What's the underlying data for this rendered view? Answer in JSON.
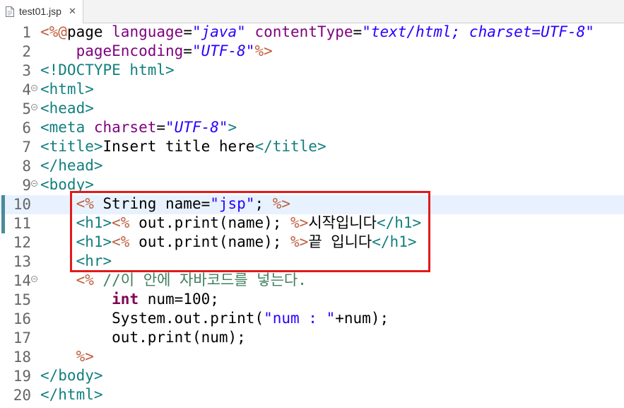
{
  "tab": {
    "label": "test01.jsp",
    "file_icon": "jsp-file-icon",
    "close_icon": "close-icon"
  },
  "colors": {
    "jsp_delimiter": "#bf5f3f",
    "tag": "#127f7f",
    "attribute": "#7f007f",
    "string": "#2a00ff",
    "keyword": "#7f0055",
    "comment": "#3f7f5f",
    "highlight": "#e21a1a",
    "current_line": "#e8f2fe"
  },
  "editor": {
    "current_line": 10,
    "highlighted_lines": [
      10,
      11,
      12,
      13
    ],
    "lines": [
      {
        "n": "1",
        "fold": false,
        "indent": "",
        "tokens": [
          [
            "jsp",
            "<%@"
          ],
          [
            "",
            "page "
          ],
          [
            "attr",
            "language"
          ],
          [
            "",
            "="
          ],
          [
            "str",
            "\"java\""
          ],
          [
            "",
            ""
          ],
          [
            "attr",
            " contentType"
          ],
          [
            "",
            "="
          ],
          [
            "str",
            "\"text/html; charset=UTF-8\""
          ]
        ]
      },
      {
        "n": "2",
        "fold": false,
        "indent": "    ",
        "tokens": [
          [
            "attr",
            "pageEncoding"
          ],
          [
            "",
            "="
          ],
          [
            "str",
            "\"UTF-8\""
          ],
          [
            "jsp",
            "%>"
          ]
        ]
      },
      {
        "n": "3",
        "fold": false,
        "indent": "",
        "tokens": [
          [
            "tag",
            "<!DOCTYPE html>"
          ]
        ]
      },
      {
        "n": "4",
        "fold": true,
        "indent": "",
        "tokens": [
          [
            "tag",
            "<html>"
          ]
        ]
      },
      {
        "n": "5",
        "fold": true,
        "indent": "",
        "tokens": [
          [
            "tag",
            "<head>"
          ]
        ]
      },
      {
        "n": "6",
        "fold": false,
        "indent": "",
        "tokens": [
          [
            "tag",
            "<meta "
          ],
          [
            "attr",
            "charset"
          ],
          [
            "",
            "="
          ],
          [
            "str",
            "\"UTF-8\""
          ],
          [
            "tag",
            ">"
          ]
        ]
      },
      {
        "n": "7",
        "fold": false,
        "indent": "",
        "tokens": [
          [
            "tag",
            "<title>"
          ],
          [
            "",
            "Insert title here"
          ],
          [
            "tag",
            "</title>"
          ]
        ]
      },
      {
        "n": "8",
        "fold": false,
        "indent": "",
        "tokens": [
          [
            "tag",
            "</head>"
          ]
        ]
      },
      {
        "n": "9",
        "fold": true,
        "indent": "",
        "tokens": [
          [
            "tag",
            "<body>"
          ]
        ]
      },
      {
        "n": "10",
        "fold": false,
        "indent": "    ",
        "tokens": [
          [
            "jsp",
            "<%"
          ],
          [
            "",
            " String name="
          ],
          [
            "javastr",
            "\"jsp\""
          ],
          [
            "",
            "; "
          ],
          [
            "jsp",
            "%>"
          ]
        ]
      },
      {
        "n": "11",
        "fold": false,
        "indent": "    ",
        "tokens": [
          [
            "tag",
            "<h1>"
          ],
          [
            "jsp",
            "<%"
          ],
          [
            "",
            " out.print(name); "
          ],
          [
            "jsp",
            "%>"
          ],
          [
            "",
            "시작입니다"
          ],
          [
            "tag",
            "</h1>"
          ]
        ]
      },
      {
        "n": "12",
        "fold": false,
        "indent": "    ",
        "tokens": [
          [
            "tag",
            "<h1>"
          ],
          [
            "jsp",
            "<%"
          ],
          [
            "",
            " out.print(name); "
          ],
          [
            "jsp",
            "%>"
          ],
          [
            "",
            "끝 입니다"
          ],
          [
            "tag",
            "</h1>"
          ]
        ]
      },
      {
        "n": "13",
        "fold": false,
        "indent": "    ",
        "tokens": [
          [
            "tag",
            "<hr>"
          ]
        ]
      },
      {
        "n": "14",
        "fold": true,
        "indent": "    ",
        "tokens": [
          [
            "jsp",
            "<%"
          ],
          [
            "cmt",
            " //이 안에 자바코드를 넣는다."
          ]
        ]
      },
      {
        "n": "15",
        "fold": false,
        "indent": "        ",
        "tokens": [
          [
            "kw",
            "int"
          ],
          [
            "",
            " num=100;"
          ]
        ]
      },
      {
        "n": "16",
        "fold": false,
        "indent": "        ",
        "tokens": [
          [
            "",
            "System.out.print("
          ],
          [
            "javastr",
            "\"num : \""
          ],
          [
            "",
            "+num);"
          ]
        ]
      },
      {
        "n": "17",
        "fold": false,
        "indent": "        ",
        "tokens": [
          [
            "",
            "out.print(num);"
          ]
        ]
      },
      {
        "n": "18",
        "fold": false,
        "indent": "    ",
        "tokens": [
          [
            "jsp",
            "%>"
          ]
        ]
      },
      {
        "n": "19",
        "fold": false,
        "indent": "",
        "tokens": [
          [
            "tag",
            "</body>"
          ]
        ]
      },
      {
        "n": "20",
        "fold": false,
        "indent": "",
        "tokens": [
          [
            "tag",
            "</html>"
          ]
        ]
      }
    ]
  }
}
